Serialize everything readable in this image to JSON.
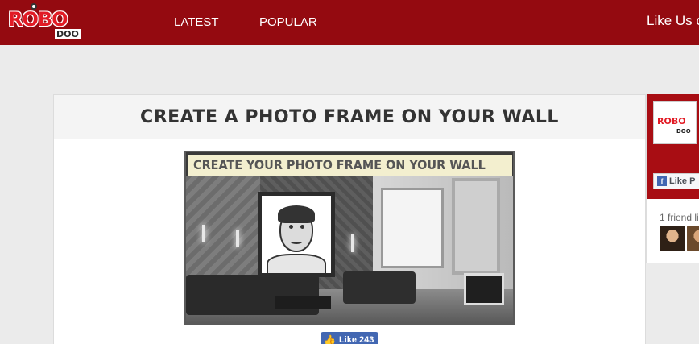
{
  "header": {
    "logo_main": "ROBO",
    "logo_sub": "DOO",
    "nav": [
      "LATEST",
      "POPULAR"
    ],
    "like_us": "Like Us o"
  },
  "main": {
    "title": "CREATE A PHOTO FRAME ON YOUR WALL",
    "preview_caption": "CREATE YOUR PHOTO FRAME ON YOUR WALL",
    "like_button": "Like 243"
  },
  "sidebar_widget": {
    "logo_main": "ROBO",
    "logo_sub": "DOO",
    "like_label": "Like P",
    "friends_text": "1 friend li"
  },
  "colors": {
    "header": "#940a10",
    "brand_red": "#e21b25",
    "facebook_blue": "#4267b2"
  },
  "icons": {
    "fb_like": "thumbs-up-icon",
    "fb_square": "facebook-icon"
  }
}
